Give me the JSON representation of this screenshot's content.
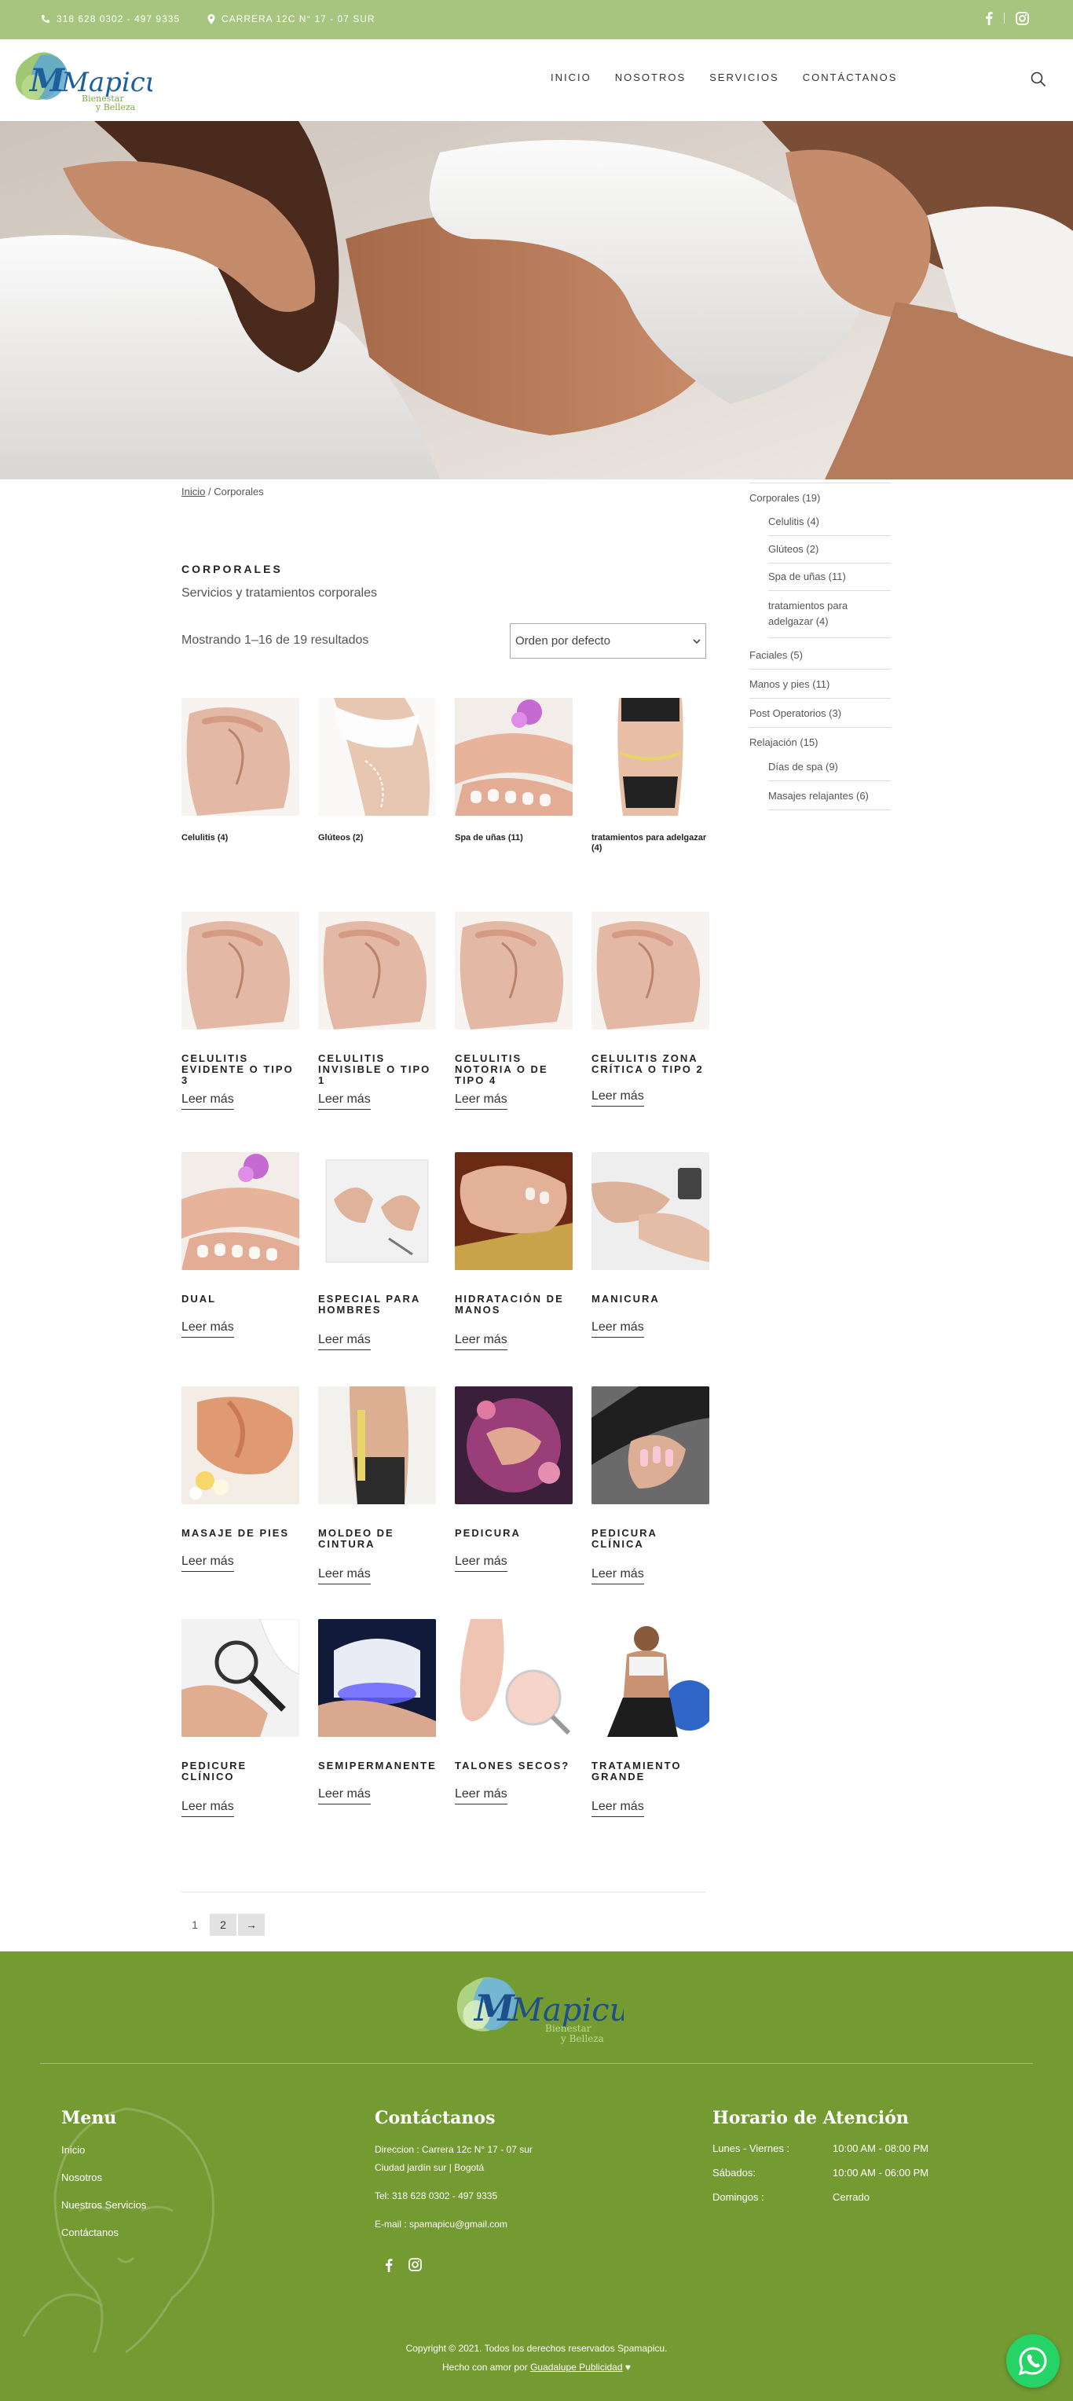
{
  "topbar": {
    "phone": "318 628 0302 - 497 9335",
    "address": "CARRERA 12C N° 17 - 07 SUR",
    "social": [
      "facebook-icon",
      "instagram-icon"
    ]
  },
  "header": {
    "logo_text": "Mapicu",
    "logo_sub1": "Bienestar",
    "logo_sub2": "y Belleza",
    "nav": [
      "INICIO",
      "NOSOTROS",
      "SERVICIOS",
      "CONTÁCTANOS"
    ]
  },
  "breadcrumb": {
    "home": "Inicio",
    "current": "Corporales"
  },
  "page": {
    "title": "CORPORALES",
    "description": "Servicios y tratamientos corporales",
    "result_count": "Mostrando 1–16 de 19 resultados",
    "ordering": "Orden por defecto"
  },
  "subcategories": [
    {
      "name": "Celulitis",
      "count": "(4)"
    },
    {
      "name": "Glúteos",
      "count": "(2)"
    },
    {
      "name": "Spa de uñas",
      "count": "(11)"
    },
    {
      "name": "tratamientos para adelgazar",
      "count": "(4)"
    }
  ],
  "products": [
    {
      "title": "CELULITIS EVIDENTE O TIPO 3",
      "more": "Leer más"
    },
    {
      "title": "CELULITIS INVISIBLE O TIPO 1",
      "more": "Leer más"
    },
    {
      "title": "CELULITIS NOTORIA O DE TIPO 4",
      "more": "Leer más"
    },
    {
      "title": "CELULITIS ZONA CRÍTICA O TIPO 2",
      "more": "Leer más"
    },
    {
      "title": "DUAL",
      "more": "Leer más"
    },
    {
      "title": "ESPECIAL PARA HOMBRES",
      "more": "Leer más"
    },
    {
      "title": "HIDRATACIÓN DE MANOS",
      "more": "Leer más"
    },
    {
      "title": "MANICURA",
      "more": "Leer más"
    },
    {
      "title": "MASAJE DE PIES",
      "more": "Leer más"
    },
    {
      "title": "MOLDEO DE CINTURA",
      "more": "Leer más"
    },
    {
      "title": "PEDICURA",
      "more": "Leer más"
    },
    {
      "title": "PEDICURA CLÍNICA",
      "more": "Leer más"
    },
    {
      "title": "PEDICURE CLÍNICO",
      "more": "Leer más"
    },
    {
      "title": "SEMIPERMANENTE",
      "more": "Leer más"
    },
    {
      "title": "TALONES SECOS?",
      "more": "Leer más"
    },
    {
      "title": "TRATAMIENTO GRANDE",
      "more": "Leer más"
    }
  ],
  "pagination": {
    "page1": "1",
    "page2": "2",
    "next": "→"
  },
  "sidebar": {
    "corporales": "Corporales (19)",
    "celulitis": "Celulitis (4)",
    "gluteos": "Glúteos (2)",
    "spa": "Spa de uñas (11)",
    "adelgazar1": "tratamientos para",
    "adelgazar2": "adelgazar (4)",
    "faciales": "Faciales (5)",
    "manos": "Manos y pies (11)",
    "post": "Post Operatorios (3)",
    "relajacion": "Relajación (15)",
    "dias": "Días de spa (9)",
    "masajes": "Masajes relajantes (6)"
  },
  "footer": {
    "menu_title": "Menu",
    "menu": [
      "Inicio",
      "Nosotros",
      "Nuestros Servicios",
      "Contáctanos"
    ],
    "contact_title": "Contáctanos",
    "address1": "Direccion : Carrera 12c N° 17 - 07 sur",
    "address2": "Ciudad jardín sur | Bogotá",
    "tel": "Tel: 318 628 0302 - 497 9335",
    "email": "E-mail : spamapicu@gmail.com",
    "hours_title": "Horario de Atención",
    "hours": [
      {
        "day": "Lunes - Viernes :",
        "time": "10:00 AM - 08:00 PM"
      },
      {
        "day": "Sábados:",
        "time": "10:00 AM - 06:00 PM"
      },
      {
        "day": "Domingos :",
        "time": "Cerrado"
      }
    ],
    "copyright": "Copyright © 2021. Todos los derechos reservados Spamapicu.",
    "made_prefix": "Hecho con amor por",
    "made_link": "Guadalupe Publicidad"
  },
  "colors": {
    "topbar": "#a7c57f",
    "footer": "#749a32",
    "whatsapp": "#25d366"
  }
}
